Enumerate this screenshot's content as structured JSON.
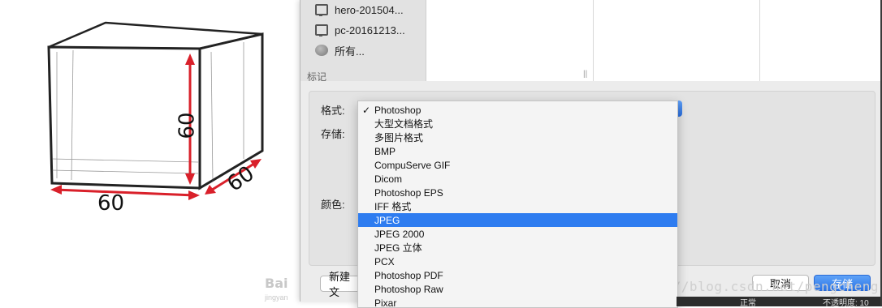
{
  "illustration": {
    "dim_height": "60",
    "dim_width": "60",
    "dim_depth": "60",
    "watermark": "Bai",
    "watermark_sub": "jingyan"
  },
  "sidebar": {
    "items": [
      {
        "label": "hero-201504...",
        "icon": "monitor-icon"
      },
      {
        "label": "pc-20161213...",
        "icon": "monitor-icon"
      },
      {
        "label": "所有...",
        "icon": "globe-icon"
      }
    ],
    "heading": "标记",
    "column_handle": "||"
  },
  "options": {
    "format_label": "格式:",
    "save_label": "存储:",
    "color_label": "颜色:"
  },
  "format_menu": {
    "selected_value": "Photoshop",
    "highlighted": "JPEG",
    "items": [
      "Photoshop",
      "大型文档格式",
      "多图片格式",
      "BMP",
      "CompuServe GIF",
      "Dicom",
      "Photoshop EPS",
      "IFF 格式",
      "JPEG",
      "JPEG 2000",
      "JPEG 立体",
      "PCX",
      "Photoshop PDF",
      "Photoshop Raw",
      "Pixar"
    ],
    "check_mark": "✓"
  },
  "buttons": {
    "new_folder": "新建文",
    "cancel": "取消",
    "save": "存储"
  },
  "watermark_url": "http://blog.csdn.net/pengcheng",
  "status_bar": {
    "left": "正常",
    "right": "不透明度: 10"
  },
  "colors": {
    "accent": "#2e7cf0",
    "arrow": "#d9202a"
  }
}
